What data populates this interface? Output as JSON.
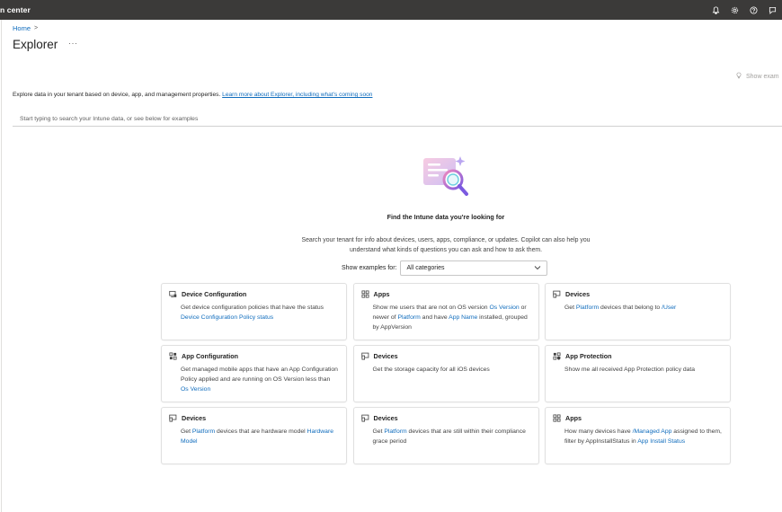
{
  "topbar": {
    "title": "n center"
  },
  "breadcrumb": {
    "home": "Home",
    "separator": ">"
  },
  "page": {
    "title": "Explorer",
    "more": "···"
  },
  "toolbar": {
    "show_examples": "Show exam"
  },
  "description": {
    "text": "Explore data in your tenant based on device, app, and management properties.",
    "link": "Learn more about Explorer, including what's coming soon"
  },
  "search": {
    "placeholder": "Start typing to search your Intune data, or see below for examples"
  },
  "empty_state": {
    "title": "Find the Intune data you're looking for",
    "subtext": "Search your tenant for info about devices, users, apps, compliance, or updates. Copilot can also help you understand what kinds of questions you can ask and how to ask them."
  },
  "filter": {
    "label": "Show examples for:",
    "value": "All categories"
  },
  "cards": [
    {
      "icon": "device-configuration-icon",
      "title": "Device Configuration",
      "parts": [
        {
          "t": "Get device configuration policies that have the status "
        },
        {
          "t": "Device Configuration Policy status",
          "token": true
        }
      ]
    },
    {
      "icon": "apps-icon",
      "title": "Apps",
      "parts": [
        {
          "t": "Show me users that are not on OS version "
        },
        {
          "t": "Os Version",
          "token": true
        },
        {
          "t": " or newer of "
        },
        {
          "t": "Platform",
          "token": true
        },
        {
          "t": " and have "
        },
        {
          "t": "App Name",
          "token": true
        },
        {
          "t": " installed, grouped by AppVersion"
        }
      ]
    },
    {
      "icon": "devices-icon",
      "title": "Devices",
      "parts": [
        {
          "t": "Get "
        },
        {
          "t": "Platform",
          "token": true
        },
        {
          "t": " devices that belong to "
        },
        {
          "t": "/User",
          "token": true
        }
      ]
    },
    {
      "icon": "app-configuration-icon",
      "title": "App Configuration",
      "parts": [
        {
          "t": "Get managed mobile apps that have an App Configuration Policy applied and are running on OS Version less than "
        },
        {
          "t": "Os Version",
          "token": true
        }
      ]
    },
    {
      "icon": "devices-icon",
      "title": "Devices",
      "parts": [
        {
          "t": "Get the storage capacity for all iOS devices"
        }
      ]
    },
    {
      "icon": "app-protection-icon",
      "title": "App Protection",
      "parts": [
        {
          "t": "Show me all received App Protection policy data"
        }
      ]
    },
    {
      "icon": "devices-icon",
      "title": "Devices",
      "parts": [
        {
          "t": "Get "
        },
        {
          "t": "Platform",
          "token": true
        },
        {
          "t": " devices that are hardware model "
        },
        {
          "t": "Hardware Model",
          "token": true
        }
      ]
    },
    {
      "icon": "devices-icon",
      "title": "Devices",
      "parts": [
        {
          "t": "Get "
        },
        {
          "t": "Platform",
          "token": true
        },
        {
          "t": " devices that are still within their compliance grace period"
        }
      ]
    },
    {
      "icon": "apps-icon",
      "title": "Apps",
      "parts": [
        {
          "t": "How many devices have "
        },
        {
          "t": "/Managed App",
          "token": true
        },
        {
          "t": " assigned to them, filter by AppInstallStatus in "
        },
        {
          "t": "App Install Status",
          "token": true
        }
      ]
    }
  ],
  "colors": {
    "topbar": "#3b3a39",
    "link": "#0f6cbd",
    "text": "#242424"
  }
}
